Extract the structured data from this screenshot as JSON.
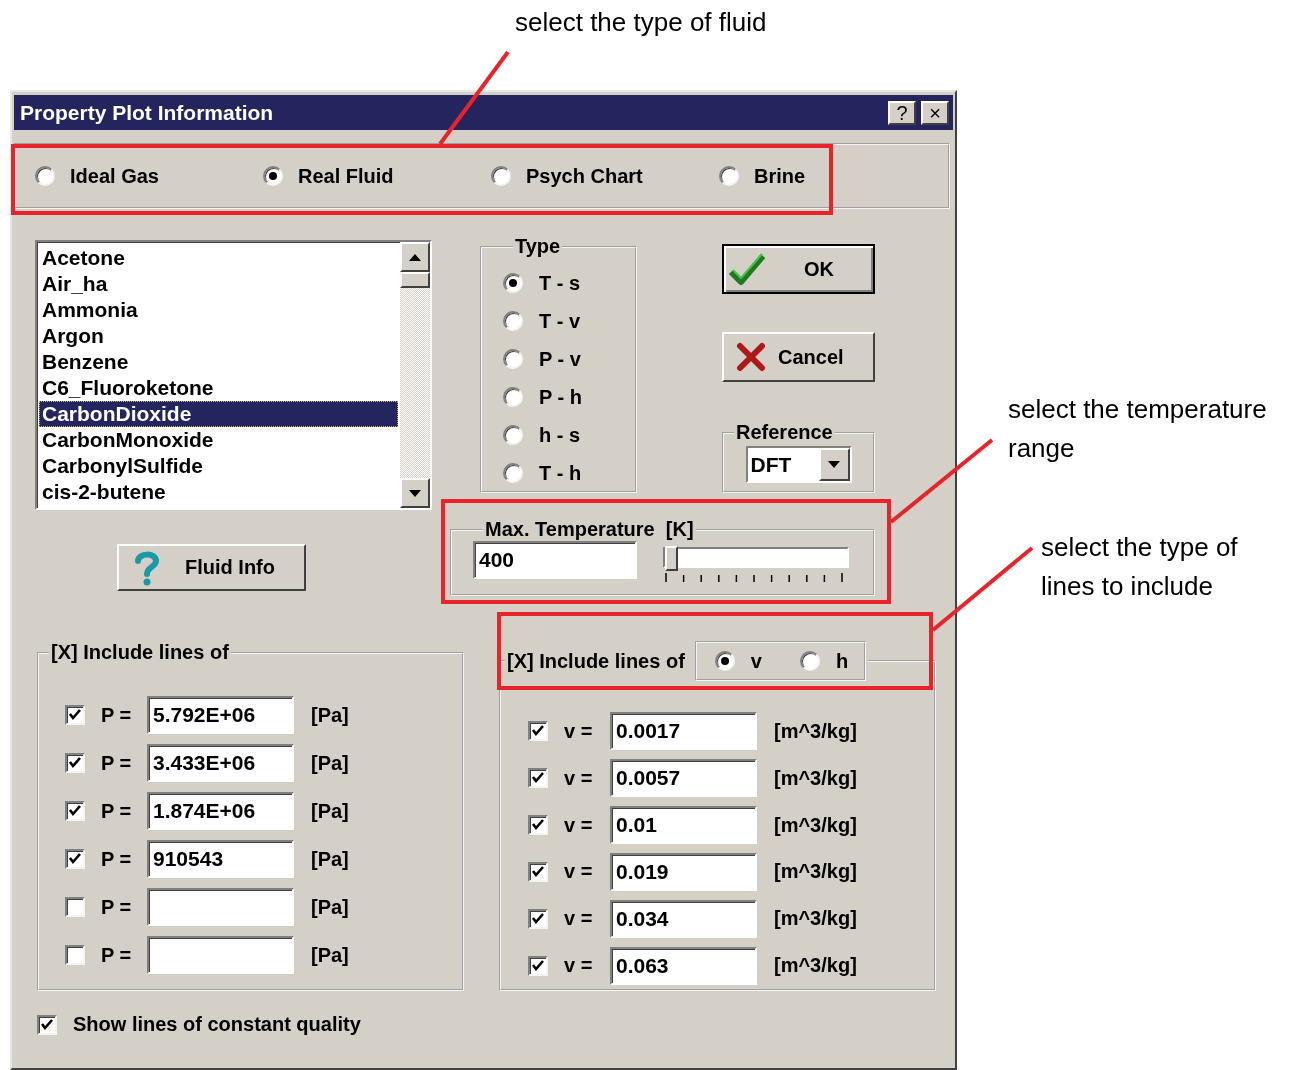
{
  "annotations": [
    {
      "text": "select the type of fluid"
    },
    {
      "text": "select the temperature range"
    },
    {
      "text": "select the type of lines to include"
    }
  ],
  "window": {
    "title": "Property Plot Information",
    "help_button": "?",
    "close_button": "×"
  },
  "fluid_types": [
    {
      "label": "Ideal Gas",
      "selected": false
    },
    {
      "label": "Real Fluid",
      "selected": true
    },
    {
      "label": "Psych Chart",
      "selected": false
    },
    {
      "label": "Brine",
      "selected": false
    }
  ],
  "fluids": [
    {
      "label": "Acetone",
      "selected": false
    },
    {
      "label": "Air_ha",
      "selected": false
    },
    {
      "label": "Ammonia",
      "selected": false
    },
    {
      "label": "Argon",
      "selected": false
    },
    {
      "label": "Benzene",
      "selected": false
    },
    {
      "label": "C6_Fluoroketone",
      "selected": false
    },
    {
      "label": "CarbonDioxide",
      "selected": true
    },
    {
      "label": "CarbonMonoxide",
      "selected": false
    },
    {
      "label": "CarbonylSulfide",
      "selected": false
    },
    {
      "label": "cis-2-butene",
      "selected": false
    }
  ],
  "type_group": {
    "title": "Type",
    "options": [
      {
        "label": "T - s",
        "selected": true
      },
      {
        "label": "T - v",
        "selected": false
      },
      {
        "label": "P - v",
        "selected": false
      },
      {
        "label": "P - h",
        "selected": false
      },
      {
        "label": "h - s",
        "selected": false
      },
      {
        "label": "T - h",
        "selected": false
      }
    ]
  },
  "ok_button": "OK",
  "cancel_button": "Cancel",
  "reference": {
    "title": "Reference",
    "value": "DFT"
  },
  "max_temperature": {
    "title": "Max. Temperature  [K]",
    "value": "400",
    "level": 0
  },
  "fluid_info_button": "Fluid Info",
  "pressure_lines": {
    "title": "[X] Include lines of",
    "rows": [
      {
        "checked": true,
        "label": "P =",
        "value": "5.792E+06",
        "unit": "[Pa]"
      },
      {
        "checked": true,
        "label": "P =",
        "value": "3.433E+06",
        "unit": "[Pa]"
      },
      {
        "checked": true,
        "label": "P =",
        "value": "1.874E+06",
        "unit": "[Pa]"
      },
      {
        "checked": true,
        "label": "P =",
        "value": "910543",
        "unit": "[Pa]"
      },
      {
        "checked": false,
        "label": "P =",
        "unit": "[Pa]"
      },
      {
        "checked": false,
        "label": "P =",
        "unit": "[Pa]"
      }
    ]
  },
  "second_lines": {
    "title": "[X] Include lines of",
    "options": [
      {
        "label": "v",
        "selected": true
      },
      {
        "label": "h",
        "selected": false
      }
    ],
    "rows": [
      {
        "checked": true,
        "label": "v =",
        "value": "0.0017",
        "unit": "[m^3/kg]"
      },
      {
        "checked": true,
        "label": "v =",
        "value": "0.0057",
        "unit": "[m^3/kg]"
      },
      {
        "checked": true,
        "label": "v =",
        "value": "0.01",
        "unit": "[m^3/kg]"
      },
      {
        "checked": true,
        "label": "v =",
        "value": "0.019",
        "unit": "[m^3/kg]"
      },
      {
        "checked": true,
        "label": "v =",
        "value": "0.034",
        "unit": "[m^3/kg]"
      },
      {
        "checked": true,
        "label": "v =",
        "value": "0.063",
        "unit": "[m^3/kg]"
      }
    ]
  },
  "quality": {
    "label": "Show lines of constant quality",
    "checked": true
  }
}
